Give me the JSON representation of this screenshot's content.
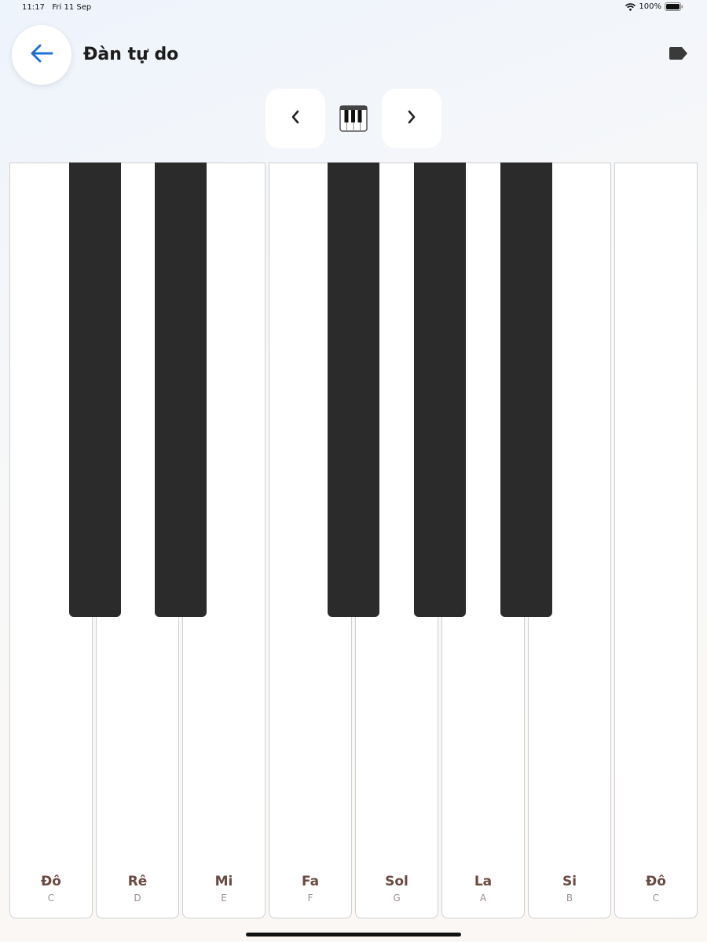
{
  "status_bar": {
    "time": "11:17",
    "date": "Fri 11 Sep",
    "battery": "100%"
  },
  "header": {
    "title": "Đàn tự do",
    "back_icon": "arrow-left-icon",
    "tag_icon": "tag-icon"
  },
  "octave_nav": {
    "prev_icon": "chevron-left-icon",
    "center_icon": "piano-icon",
    "next_icon": "chevron-right-icon"
  },
  "keyboard": {
    "white_keys": [
      {
        "note": "Đô",
        "letter": "C"
      },
      {
        "note": "Rê",
        "letter": "D"
      },
      {
        "note": "Mi",
        "letter": "E"
      },
      {
        "note": "Fa",
        "letter": "F"
      },
      {
        "note": "Sol",
        "letter": "G"
      },
      {
        "note": "La",
        "letter": "A"
      },
      {
        "note": "Si",
        "letter": "B"
      },
      {
        "note": "Đô",
        "letter": "C"
      }
    ],
    "black_keys": [
      "C#",
      "D#",
      "F#",
      "G#",
      "A#"
    ]
  },
  "colors": {
    "accent": "#1f6fd8",
    "black_key": "#2b2b2b",
    "note_label": "#6b4a42"
  }
}
